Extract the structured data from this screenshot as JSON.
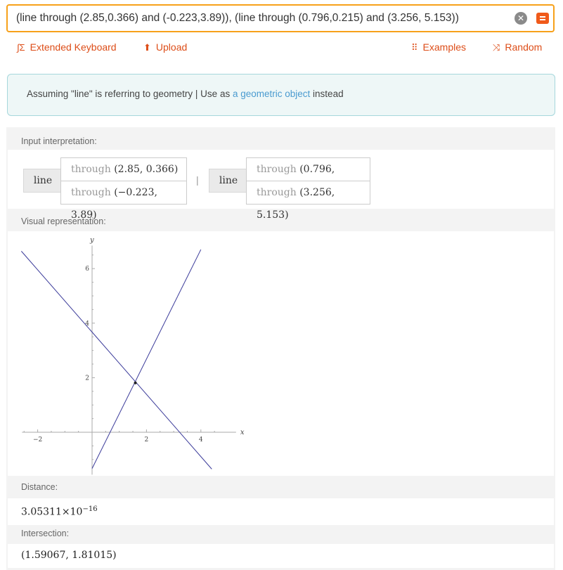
{
  "search": {
    "query": "(line through (2.85,0.366) and (-0.223,3.89)), (line through (0.796,0.215) and (3.256, 5.153))",
    "clear_icon": "close-icon",
    "submit_icon": "equals-icon"
  },
  "toolbar": {
    "keyboard_label": "Extended Keyboard",
    "upload_label": "Upload",
    "examples_label": "Examples",
    "random_label": "Random"
  },
  "assumption": {
    "text": "Assuming \"line\" is referring to geometry | Use as",
    "link": "a geometric object",
    "suffix": "instead"
  },
  "sections": {
    "input_interpretation": "Input interpretation:",
    "visual_representation": "Visual representation:",
    "distance": "Distance:",
    "intersection": "Intersection:"
  },
  "interpretation": {
    "line1": {
      "head": "line",
      "through1_word": "through",
      "through1_value": "(2.85, 0.366)",
      "through2_word": "through",
      "through2_value": "(−0.223, 3.89)"
    },
    "separator": "|",
    "line2": {
      "head": "line",
      "through1_word": "through",
      "through1_value": "(0.796, 0.215)",
      "through2_word": "through",
      "through2_value": "(3.256, 5.153)"
    }
  },
  "distance": {
    "mantissa": "3.05311",
    "times": "×",
    "base": "10",
    "exponent": "−16"
  },
  "intersection": {
    "value": "(1.59067, 1.81015)"
  },
  "chart_data": {
    "type": "line",
    "xlabel": "x",
    "ylabel": "y",
    "xlim": [
      -2.6,
      5.5
    ],
    "ylim": [
      -1.4,
      7.0
    ],
    "x_ticks": [
      -2,
      2,
      4
    ],
    "y_ticks": [
      2,
      4,
      6
    ],
    "series": [
      {
        "points": [
          [
            -2.6,
            6.64
          ],
          [
            4.4,
            -1.35
          ]
        ],
        "color": "#3b3b9a"
      },
      {
        "points": [
          [
            0.0,
            -1.33
          ],
          [
            4.0,
            6.7
          ]
        ],
        "color": "#3b3b9a"
      }
    ],
    "intersection_point": [
      1.59067,
      1.81015
    ]
  }
}
